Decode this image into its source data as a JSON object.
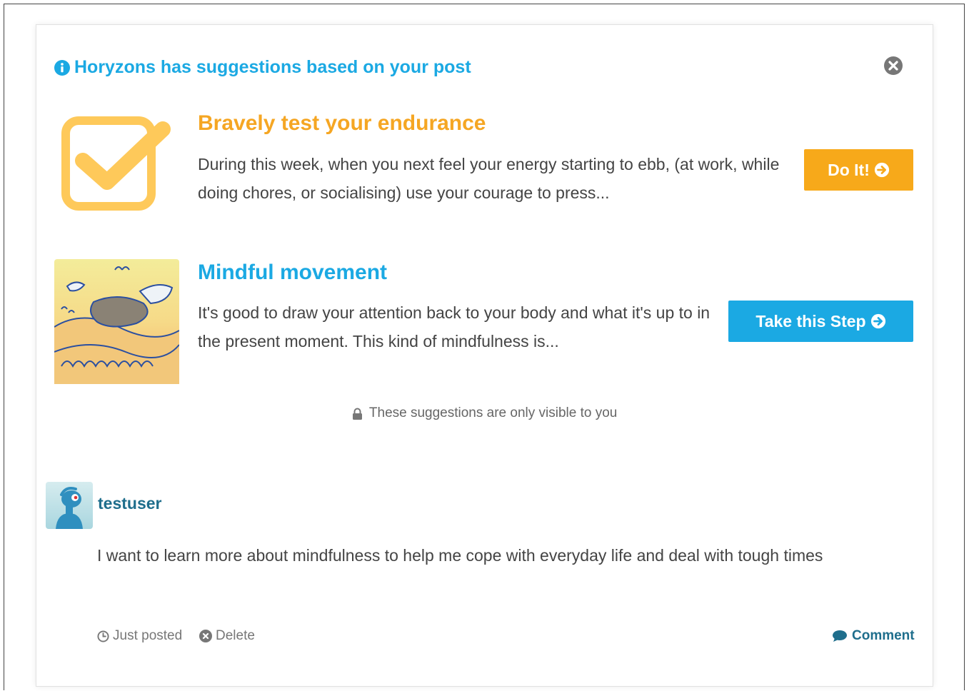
{
  "header": {
    "text": "Horyzons has suggestions based on your post"
  },
  "suggestions": [
    {
      "title": "Bravely test your endurance",
      "description": "During this week, when you next feel your energy starting to ebb, (at work, while doing chores, or socialising) use your courage to press...",
      "button_label": "Do It!",
      "icon": "checkbox-icon"
    },
    {
      "title": "Mindful movement",
      "description": "It's good to draw your attention back to your body and what it's up to in the present moment. This kind of mindfulness is...",
      "button_label": "Take this Step",
      "icon": "illustration-image"
    }
  ],
  "visibility_note": "These suggestions are only visible to you",
  "post": {
    "username": "testuser",
    "body": "I want to learn more about mindfulness to help me cope with everyday life and deal with tough times",
    "timestamp": "Just posted",
    "delete_label": "Delete",
    "comment_label": "Comment"
  },
  "colors": {
    "accent_blue": "#1ba9e3",
    "accent_orange": "#f7a91a",
    "username": "#1f6e8c"
  }
}
